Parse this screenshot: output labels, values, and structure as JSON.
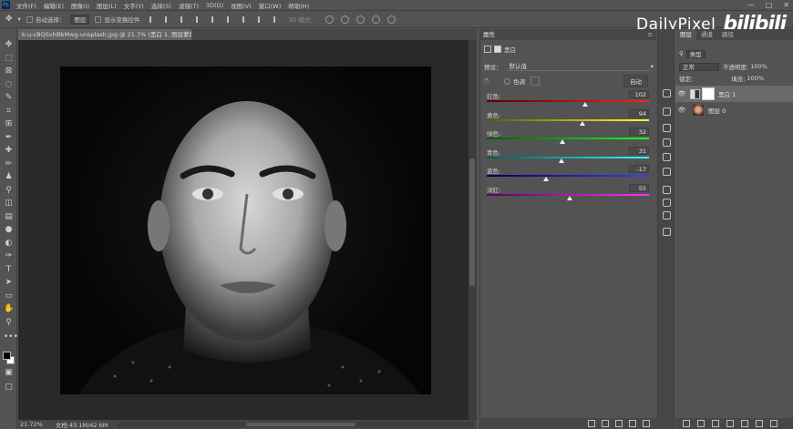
{
  "menubar": {
    "logo": "Ps",
    "items": [
      "文件(F)",
      "编辑(E)",
      "图像(I)",
      "图层(L)",
      "文字(Y)",
      "选择(S)",
      "滤镜(T)",
      "3D(D)",
      "视图(V)",
      "窗口(W)",
      "帮助(H)"
    ],
    "window_buttons": [
      "—",
      "□",
      "✕"
    ]
  },
  "options_bar": {
    "auto_select_label": "自动选择：",
    "auto_select_value": "图层",
    "show_transform_label": "显示变换控件",
    "mode_3d_label": "3D 模式："
  },
  "document": {
    "tab_title": "k-u-cBQSvhBbMwg-unsplash.jpg @ 21.7% (黑白 1, 图层蒙版/8) *",
    "close_glyph": "×"
  },
  "status_bar": {
    "zoom": "21.72%",
    "doc_info": "文档:43.1M/42.6M"
  },
  "properties": {
    "panel_title": "属性",
    "adjustment_name": "黑白",
    "preset_label": "预设：",
    "preset_value": "默认值",
    "tint_label": "色调",
    "auto_button": "自动",
    "sliders": [
      {
        "label": "红色:",
        "value": 102,
        "color_from": "#5a0000",
        "color_to": "#ff2020"
      },
      {
        "label": "黄色:",
        "value": 94,
        "color_from": "#5a5a00",
        "color_to": "#ffff30"
      },
      {
        "label": "绿色:",
        "value": 32,
        "color_from": "#005a00",
        "color_to": "#20ff20"
      },
      {
        "label": "青色:",
        "value": 31,
        "color_from": "#005a5a",
        "color_to": "#30ffff"
      },
      {
        "label": "蓝色:",
        "value": -17,
        "color_from": "#00005a",
        "color_to": "#3040ff"
      },
      {
        "label": "洋红:",
        "value": 55,
        "color_from": "#5a005a",
        "color_to": "#ff30ff"
      }
    ],
    "slider_min": -200,
    "slider_max": 300
  },
  "layers": {
    "tabs": [
      "图层",
      "通道",
      "路径"
    ],
    "filter_value": "类型",
    "blend_mode": "正常",
    "opacity_label": "不透明度:",
    "opacity_value": "100%",
    "lock_label": "锁定:",
    "fill_label": "填充:",
    "fill_value": "100%",
    "items": [
      {
        "name": "黑白 1",
        "type": "adjustment",
        "active": true
      },
      {
        "name": "图层 0",
        "type": "photo",
        "active": false
      }
    ]
  },
  "watermark": {
    "text": "DailyPixel",
    "logo_text": "bilibili"
  }
}
